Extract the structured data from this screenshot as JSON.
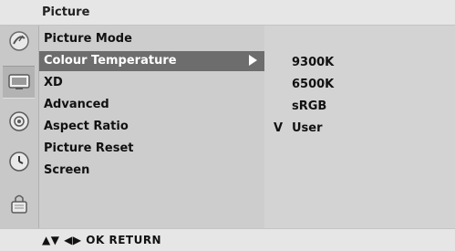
{
  "header": {
    "title": "Picture"
  },
  "sidebar": {
    "icons": [
      {
        "name": "satellite-dish-icon"
      },
      {
        "name": "tv-screen-icon"
      },
      {
        "name": "audio-disc-icon"
      },
      {
        "name": "clock-icon"
      },
      {
        "name": "lock-icon"
      }
    ]
  },
  "menu": {
    "items": [
      {
        "label": "Picture Mode"
      },
      {
        "label": "Colour Temperature"
      },
      {
        "label": "XD"
      },
      {
        "label": "Advanced"
      },
      {
        "label": "Aspect Ratio"
      },
      {
        "label": "Picture Reset"
      },
      {
        "label": "Screen"
      }
    ]
  },
  "submenu": {
    "items": [
      {
        "check": "",
        "label": "9300K"
      },
      {
        "check": "",
        "label": "6500K"
      },
      {
        "check": "",
        "label": "sRGB"
      },
      {
        "check": "V",
        "label": "User"
      }
    ]
  },
  "footer": {
    "nav_text": "▲▼ ◀▶ OK  RETURN"
  }
}
